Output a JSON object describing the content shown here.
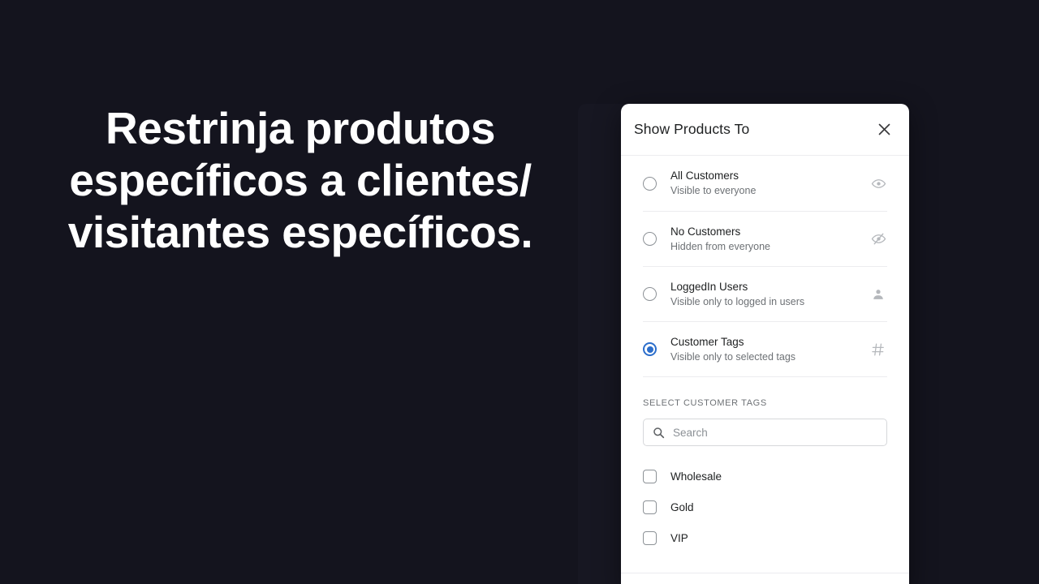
{
  "theme": {
    "background_color": "#14141e",
    "accent_color": "#2c6ecb",
    "surface_color": "#ffffff",
    "text_color": "#202223",
    "muted_text_color": "#6d7175"
  },
  "hero": {
    "headline": "Restrinja produtos\nespecíficos a clientes/\nvisitantes específicos."
  },
  "modal": {
    "title": "Show Products To",
    "close_label": "×",
    "close_icon": "close-icon",
    "options": [
      {
        "label": "All Customers",
        "description": "Visible to everyone",
        "icon": "eye-icon",
        "selected": false
      },
      {
        "label": "No Customers",
        "description": "Hidden from everyone",
        "icon": "eye-off-icon",
        "selected": false
      },
      {
        "label": "LoggedIn Users",
        "description": "Visible only to logged in users",
        "icon": "person-icon",
        "selected": false
      },
      {
        "label": "Customer Tags",
        "description": "Visible only to selected tags",
        "icon": "hashtag-icon",
        "selected": true
      }
    ],
    "tags_section": {
      "label": "SELECT CUSTOMER TAGS",
      "search": {
        "icon": "search-icon",
        "value": "",
        "placeholder": "Search"
      },
      "tags": [
        {
          "label": "Wholesale",
          "checked": false
        },
        {
          "label": "Gold",
          "checked": false
        },
        {
          "label": "VIP",
          "checked": false
        }
      ]
    }
  }
}
